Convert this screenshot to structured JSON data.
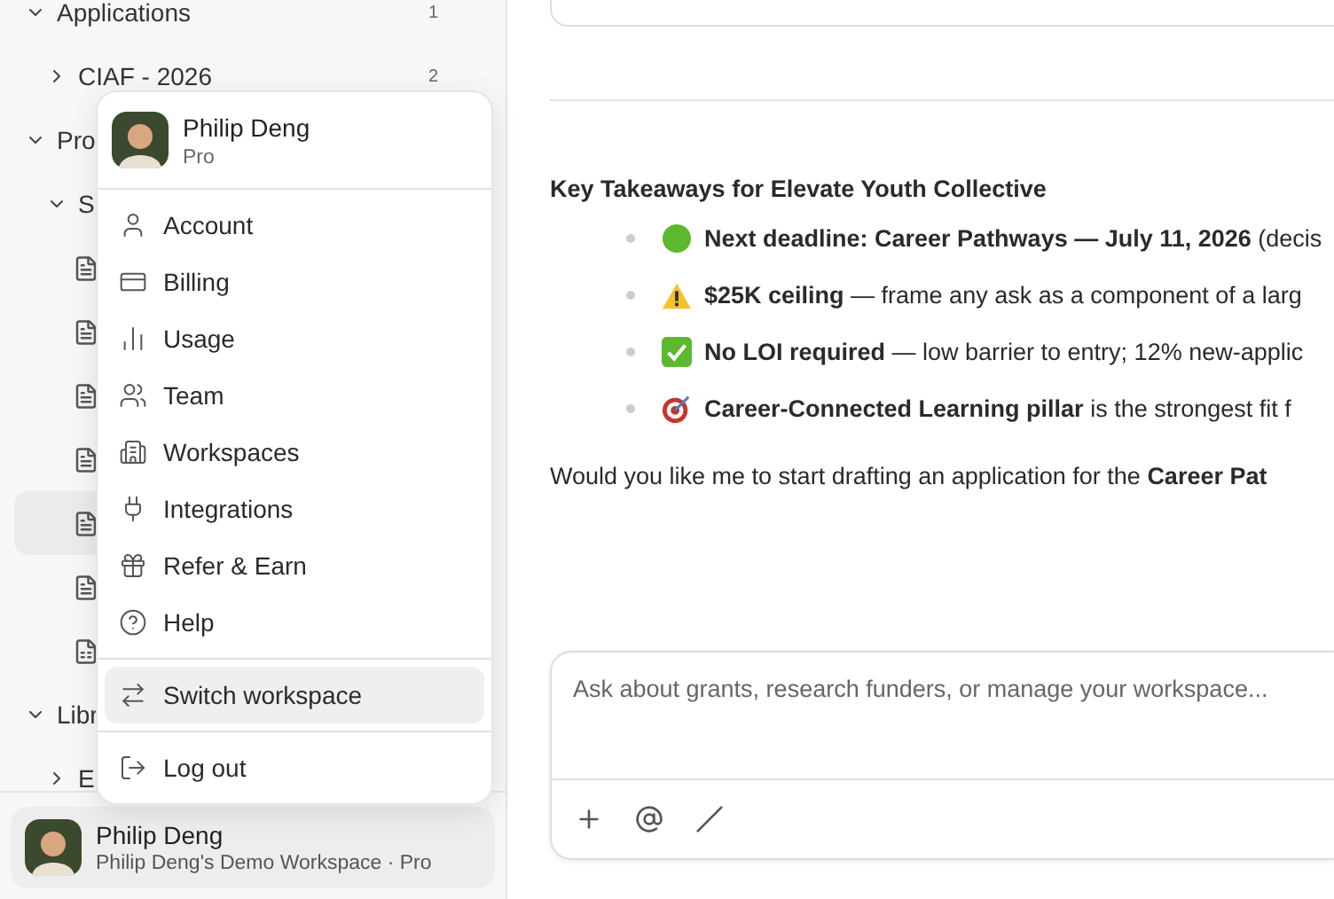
{
  "sidebar": {
    "tree": [
      {
        "label": "Applications",
        "count": "1",
        "expanded": true,
        "children": [
          {
            "label": "CIAF - 2026",
            "count": "2",
            "expanded": false
          }
        ]
      },
      {
        "label": "Pro",
        "expanded": true,
        "children": [
          {
            "label": "S",
            "expanded": true,
            "children": [
              {
                "kind": "doc",
                "selected": false
              },
              {
                "kind": "doc",
                "selected": false
              },
              {
                "kind": "doc",
                "selected": false
              },
              {
                "kind": "doc",
                "selected": false
              },
              {
                "kind": "doc",
                "selected": true
              },
              {
                "kind": "doc",
                "selected": false
              },
              {
                "kind": "sheet",
                "selected": false
              }
            ]
          }
        ]
      },
      {
        "label": "Libr",
        "expanded": true,
        "children": [
          {
            "label": "E",
            "expanded": false
          }
        ]
      }
    ],
    "user": {
      "name": "Philip Deng",
      "subtitle": "Philip Deng's Demo Workspace · Pro"
    }
  },
  "account_menu": {
    "name": "Philip Deng",
    "plan": "Pro",
    "groups": [
      [
        {
          "label": "Account",
          "selected": false
        },
        {
          "label": "Billing",
          "selected": false
        },
        {
          "label": "Usage",
          "selected": false
        },
        {
          "label": "Team",
          "selected": false
        },
        {
          "label": "Workspaces",
          "selected": false
        },
        {
          "label": "Integrations",
          "selected": false
        },
        {
          "label": "Refer & Earn",
          "selected": false
        },
        {
          "label": "Help",
          "selected": false
        }
      ],
      [
        {
          "label": "Switch workspace",
          "selected": true
        }
      ],
      [
        {
          "label": "Log out",
          "selected": false
        }
      ]
    ]
  },
  "chat": {
    "heading": "Key Takeaways for Elevate Youth Collective",
    "takeaways": [
      {
        "kind": "circle",
        "text": "**Next deadline: Career Pathways — July 11, 2026** (decis"
      },
      {
        "kind": "warning",
        "text": "**$25K ceiling** — frame any ask as a component of a larg"
      },
      {
        "kind": "check",
        "text": "**No LOI required** — low barrier to entry; 12% new-applic"
      },
      {
        "kind": "target",
        "text": "**Career-Connected Learning pillar** is the strongest fit f"
      }
    ],
    "question": "Would you like me to start drafting an application for the **Career Pat**",
    "composer": {
      "placeholder": "Ask about grants, research funders, or manage your workspace..."
    }
  }
}
